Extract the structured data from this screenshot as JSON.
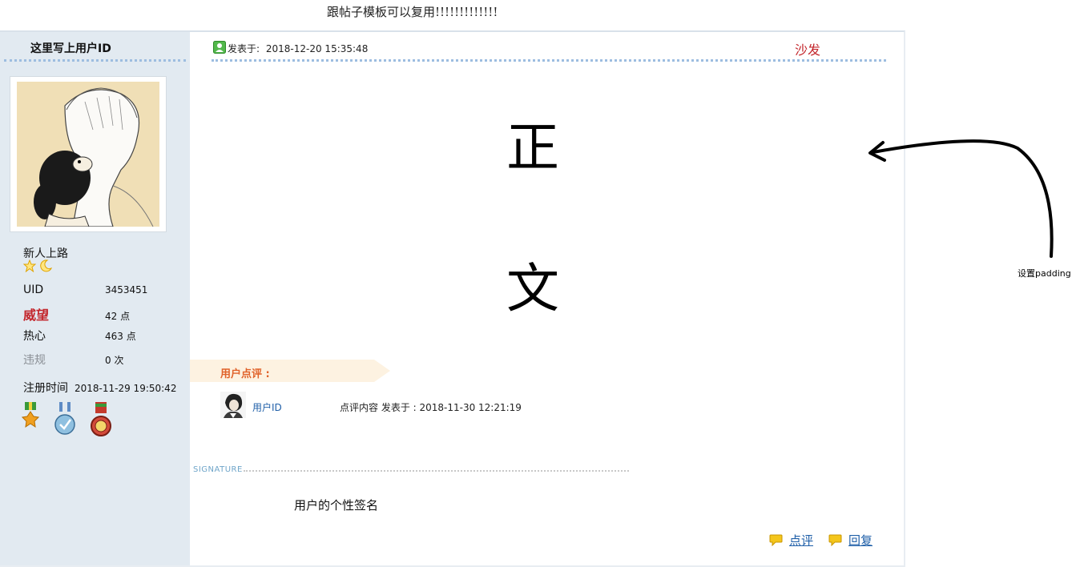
{
  "page_note": "跟帖子模板可以复用!!!!!!!!!!!!!",
  "sidebar": {
    "user_id": "这里写上用户ID",
    "group": "新人上路",
    "stats": [
      {
        "label": "UID",
        "value": "3453451"
      },
      {
        "label": "威望",
        "value": "42 点"
      },
      {
        "label": "热心",
        "value": "463 点"
      },
      {
        "label": "违规",
        "value": "0 次"
      }
    ],
    "register_label": "注册时间",
    "register_value": "2018-11-29 19:50:42"
  },
  "post": {
    "posted_label": "发表于:",
    "posted_time": "2018-12-20 15:35:48",
    "floor": "沙发",
    "body_chars": [
      "正",
      "文"
    ]
  },
  "comments": {
    "title": "用户点评 :",
    "items": [
      {
        "user": "用户ID",
        "text": "点评内容 发表于 : 2018-11-30 12:21:19"
      }
    ]
  },
  "signature": {
    "label": "SIGNATURE",
    "text": "用户的个性签名"
  },
  "actions": {
    "rate": "点评",
    "reply": "回复"
  },
  "annotation": {
    "text": "设置padding"
  },
  "colors": {
    "sidebar_bg": "#e2eaf1",
    "accent_red": "#c3252b",
    "link_blue": "#1f5fa8",
    "dots": "#9dbde0",
    "comment_orange": "#e0622a"
  }
}
